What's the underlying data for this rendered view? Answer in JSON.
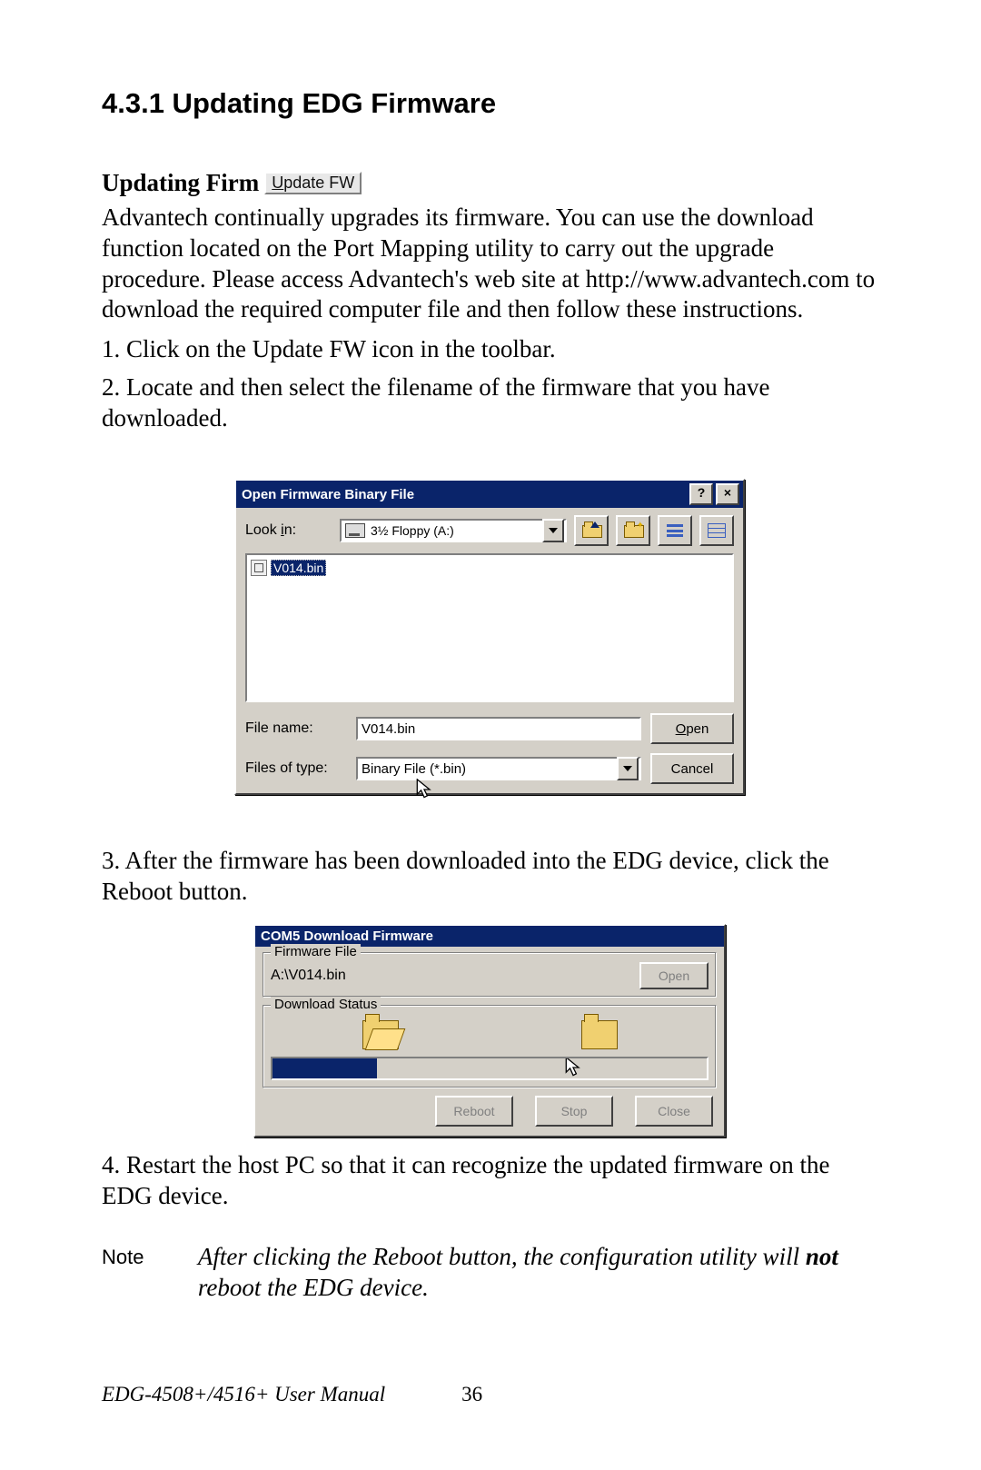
{
  "heading": "4.3.1 Updating EDG Firmware",
  "subheading_prefix": "Updating Firm",
  "toolbar_chip": {
    "u": "U",
    "rest": "pdate FW"
  },
  "paragraph": "Advantech continually upgrades its firmware. You can use the download function located on the Port Mapping utility to carry out the upgrade procedure. Please access Advantech's web site at http://www.advantech.com to download the required computer file and then follow these instructions.",
  "steps": {
    "s1": "1. Click on the Update FW icon in the toolbar.",
    "s2": "2. Locate and then select the filename of the firmware that you have downloaded.",
    "s3": "3. After the firmware has been downloaded into the EDG device, click the Reboot button.",
    "s4": "4. Restart the host PC so that it can recognize the updated firmware on the EDG device."
  },
  "ofb": {
    "title": "Open Firmware Binary File",
    "help_btn": "?",
    "close_btn": "×",
    "look_in_u": "i",
    "look_in_pre": "Look ",
    "look_in_post": "n:",
    "drive": "3½ Floppy (A:)",
    "file_listed": "V014.bin",
    "filename_label_pre": "File ",
    "filename_label_u": "n",
    "filename_label_post": "ame:",
    "filename_value": "V014.bin",
    "filetype_label_pre": "Files of ",
    "filetype_label_u": "t",
    "filetype_label_post": "ype:",
    "filetype_value": "Binary File (*.bin)",
    "open_u": "O",
    "open_rest": "pen",
    "cancel": "Cancel"
  },
  "com5": {
    "title": "COM5 Download Firmware",
    "group_firmware": "Firmware File",
    "path": "A:\\V014.bin",
    "open_label": "Open",
    "group_status": "Download Status",
    "progress_pct": 24,
    "btn_reboot": "Reboot",
    "btn_stop": "Stop",
    "btn_close": "Close"
  },
  "note": {
    "label": "Note",
    "pre": "After clicking the Reboot button, the configuration utility will ",
    "bold": "not",
    "post": " reboot the EDG device."
  },
  "footer": {
    "manual": "EDG-4508+/4516+ User Manual",
    "page": "36"
  },
  "icons": {
    "help": "help-icon",
    "close": "close-icon",
    "floppy": "floppy-drive-icon",
    "dropdown": "chevron-down-icon",
    "folder_up": "folder-up-icon",
    "new_folder": "new-folder-icon",
    "list_view": "list-view-icon",
    "details_view": "details-view-icon",
    "file": "file-icon",
    "cursor": "cursor-icon",
    "progress": "progress-bar"
  }
}
